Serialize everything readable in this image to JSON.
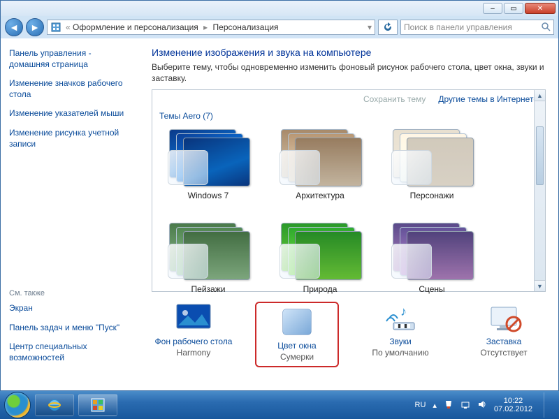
{
  "breadcrumb": {
    "level1": "Оформление и персонализация",
    "level2": "Персонализация"
  },
  "search": {
    "placeholder": "Поиск в панели управления"
  },
  "sidebar": {
    "home": "Панель управления - домашняя страница",
    "links": [
      "Изменение значков рабочего стола",
      "Изменение указателей мыши",
      "Изменение рисунка учетной записи"
    ],
    "see_also_label": "См. также",
    "see_also": [
      "Экран",
      "Панель задач и меню \"Пуск\"",
      "Центр специальных возможностей"
    ]
  },
  "main": {
    "title": "Изменение изображения и звука на компьютере",
    "desc": "Выберите тему, чтобы одновременно изменить фоновый рисунок рабочего стола, цвет окна, звуки и заставку.",
    "save_theme": "Сохранить тему",
    "more_online": "Другие темы в Интернете",
    "group_label": "Темы Aero (7)",
    "themes": [
      {
        "name": "Windows 7",
        "cls": "bg-win7"
      },
      {
        "name": "Архитектура",
        "cls": "bg-arch"
      },
      {
        "name": "Персонажи",
        "cls": "bg-pers"
      },
      {
        "name": "Пейзажи",
        "cls": "bg-land"
      },
      {
        "name": "Природа",
        "cls": "bg-nat"
      },
      {
        "name": "Сцены",
        "cls": "bg-scen"
      }
    ],
    "settings": {
      "bg": {
        "label": "Фон рабочего стола",
        "value": "Harmony"
      },
      "color": {
        "label": "Цвет окна",
        "value": "Сумерки"
      },
      "sound": {
        "label": "Звуки",
        "value": "По умолчанию"
      },
      "saver": {
        "label": "Заставка",
        "value": "Отсутствует"
      }
    }
  },
  "tray": {
    "lang": "RU",
    "time": "10:22",
    "date": "07.02.2012"
  }
}
